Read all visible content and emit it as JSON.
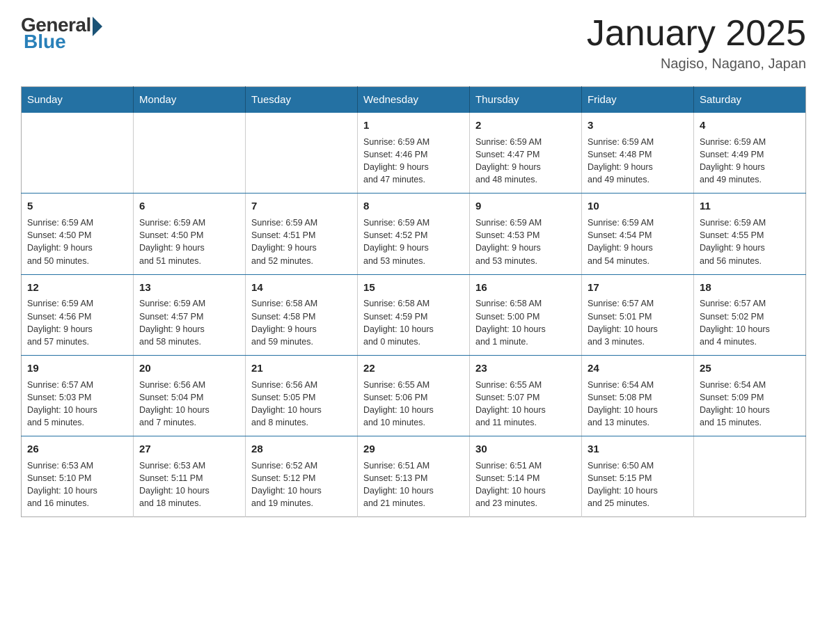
{
  "logo": {
    "general": "General",
    "blue": "Blue"
  },
  "title": "January 2025",
  "location": "Nagiso, Nagano, Japan",
  "days_of_week": [
    "Sunday",
    "Monday",
    "Tuesday",
    "Wednesday",
    "Thursday",
    "Friday",
    "Saturday"
  ],
  "weeks": [
    [
      {
        "day": "",
        "info": ""
      },
      {
        "day": "",
        "info": ""
      },
      {
        "day": "",
        "info": ""
      },
      {
        "day": "1",
        "info": "Sunrise: 6:59 AM\nSunset: 4:46 PM\nDaylight: 9 hours\nand 47 minutes."
      },
      {
        "day": "2",
        "info": "Sunrise: 6:59 AM\nSunset: 4:47 PM\nDaylight: 9 hours\nand 48 minutes."
      },
      {
        "day": "3",
        "info": "Sunrise: 6:59 AM\nSunset: 4:48 PM\nDaylight: 9 hours\nand 49 minutes."
      },
      {
        "day": "4",
        "info": "Sunrise: 6:59 AM\nSunset: 4:49 PM\nDaylight: 9 hours\nand 49 minutes."
      }
    ],
    [
      {
        "day": "5",
        "info": "Sunrise: 6:59 AM\nSunset: 4:50 PM\nDaylight: 9 hours\nand 50 minutes."
      },
      {
        "day": "6",
        "info": "Sunrise: 6:59 AM\nSunset: 4:50 PM\nDaylight: 9 hours\nand 51 minutes."
      },
      {
        "day": "7",
        "info": "Sunrise: 6:59 AM\nSunset: 4:51 PM\nDaylight: 9 hours\nand 52 minutes."
      },
      {
        "day": "8",
        "info": "Sunrise: 6:59 AM\nSunset: 4:52 PM\nDaylight: 9 hours\nand 53 minutes."
      },
      {
        "day": "9",
        "info": "Sunrise: 6:59 AM\nSunset: 4:53 PM\nDaylight: 9 hours\nand 53 minutes."
      },
      {
        "day": "10",
        "info": "Sunrise: 6:59 AM\nSunset: 4:54 PM\nDaylight: 9 hours\nand 54 minutes."
      },
      {
        "day": "11",
        "info": "Sunrise: 6:59 AM\nSunset: 4:55 PM\nDaylight: 9 hours\nand 56 minutes."
      }
    ],
    [
      {
        "day": "12",
        "info": "Sunrise: 6:59 AM\nSunset: 4:56 PM\nDaylight: 9 hours\nand 57 minutes."
      },
      {
        "day": "13",
        "info": "Sunrise: 6:59 AM\nSunset: 4:57 PM\nDaylight: 9 hours\nand 58 minutes."
      },
      {
        "day": "14",
        "info": "Sunrise: 6:58 AM\nSunset: 4:58 PM\nDaylight: 9 hours\nand 59 minutes."
      },
      {
        "day": "15",
        "info": "Sunrise: 6:58 AM\nSunset: 4:59 PM\nDaylight: 10 hours\nand 0 minutes."
      },
      {
        "day": "16",
        "info": "Sunrise: 6:58 AM\nSunset: 5:00 PM\nDaylight: 10 hours\nand 1 minute."
      },
      {
        "day": "17",
        "info": "Sunrise: 6:57 AM\nSunset: 5:01 PM\nDaylight: 10 hours\nand 3 minutes."
      },
      {
        "day": "18",
        "info": "Sunrise: 6:57 AM\nSunset: 5:02 PM\nDaylight: 10 hours\nand 4 minutes."
      }
    ],
    [
      {
        "day": "19",
        "info": "Sunrise: 6:57 AM\nSunset: 5:03 PM\nDaylight: 10 hours\nand 5 minutes."
      },
      {
        "day": "20",
        "info": "Sunrise: 6:56 AM\nSunset: 5:04 PM\nDaylight: 10 hours\nand 7 minutes."
      },
      {
        "day": "21",
        "info": "Sunrise: 6:56 AM\nSunset: 5:05 PM\nDaylight: 10 hours\nand 8 minutes."
      },
      {
        "day": "22",
        "info": "Sunrise: 6:55 AM\nSunset: 5:06 PM\nDaylight: 10 hours\nand 10 minutes."
      },
      {
        "day": "23",
        "info": "Sunrise: 6:55 AM\nSunset: 5:07 PM\nDaylight: 10 hours\nand 11 minutes."
      },
      {
        "day": "24",
        "info": "Sunrise: 6:54 AM\nSunset: 5:08 PM\nDaylight: 10 hours\nand 13 minutes."
      },
      {
        "day": "25",
        "info": "Sunrise: 6:54 AM\nSunset: 5:09 PM\nDaylight: 10 hours\nand 15 minutes."
      }
    ],
    [
      {
        "day": "26",
        "info": "Sunrise: 6:53 AM\nSunset: 5:10 PM\nDaylight: 10 hours\nand 16 minutes."
      },
      {
        "day": "27",
        "info": "Sunrise: 6:53 AM\nSunset: 5:11 PM\nDaylight: 10 hours\nand 18 minutes."
      },
      {
        "day": "28",
        "info": "Sunrise: 6:52 AM\nSunset: 5:12 PM\nDaylight: 10 hours\nand 19 minutes."
      },
      {
        "day": "29",
        "info": "Sunrise: 6:51 AM\nSunset: 5:13 PM\nDaylight: 10 hours\nand 21 minutes."
      },
      {
        "day": "30",
        "info": "Sunrise: 6:51 AM\nSunset: 5:14 PM\nDaylight: 10 hours\nand 23 minutes."
      },
      {
        "day": "31",
        "info": "Sunrise: 6:50 AM\nSunset: 5:15 PM\nDaylight: 10 hours\nand 25 minutes."
      },
      {
        "day": "",
        "info": ""
      }
    ]
  ]
}
